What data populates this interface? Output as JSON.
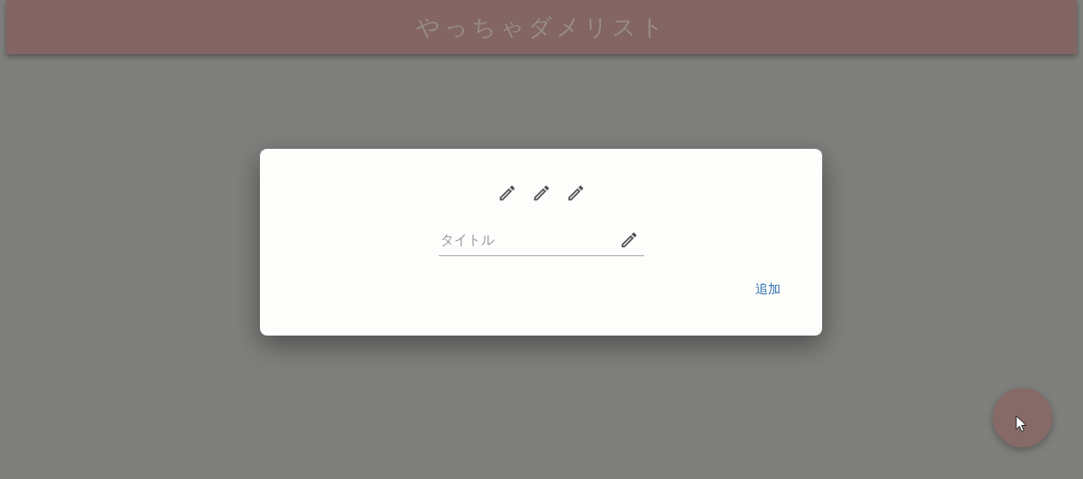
{
  "header": {
    "title": "やっちゃダメリスト"
  },
  "dialog": {
    "title_field": {
      "placeholder": "タイトル"
    },
    "add_button": "追加"
  }
}
